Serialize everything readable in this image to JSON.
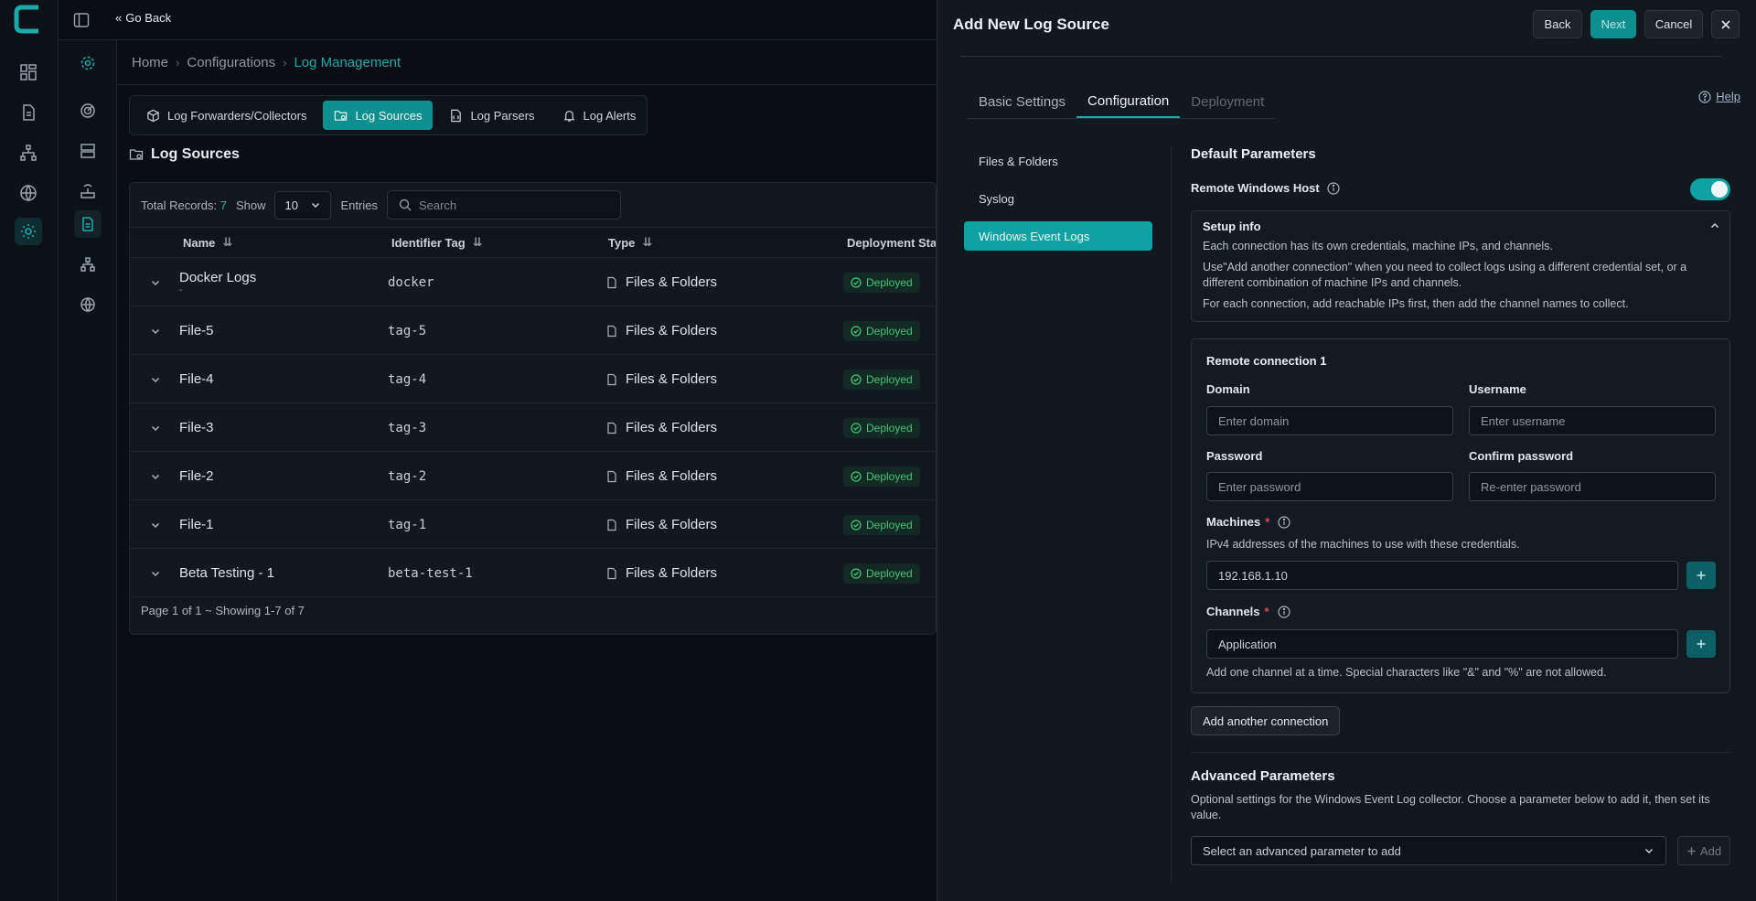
{
  "topbar": {
    "go_back": "Go Back"
  },
  "breadcrumb": {
    "home": "Home",
    "configurations": "Configurations",
    "current": "Log Management"
  },
  "tabs": {
    "forwarders": "Log Forwarders/Collectors",
    "sources": "Log Sources",
    "parsers": "Log Parsers",
    "alerts": "Log Alerts"
  },
  "section_title": "Log Sources",
  "table": {
    "total_label": "Total Records:",
    "total_count": "7",
    "show_label": "Show",
    "show_value": "10",
    "entries_label": "Entries",
    "search_placeholder": "Search",
    "columns": {
      "name": "Name",
      "tag": "Identifier Tag",
      "type": "Type",
      "status": "Deployment Status"
    },
    "rows": [
      {
        "name": "Docker Logs",
        "sub": "-",
        "tag": "docker",
        "type": "Files & Folders",
        "status": "Deployed"
      },
      {
        "name": "File-5",
        "tag": "tag-5",
        "type": "Files & Folders",
        "status": "Deployed"
      },
      {
        "name": "File-4",
        "tag": "tag-4",
        "type": "Files & Folders",
        "status": "Deployed"
      },
      {
        "name": "File-3",
        "tag": "tag-3",
        "type": "Files & Folders",
        "status": "Deployed"
      },
      {
        "name": "File-2",
        "tag": "tag-2",
        "type": "Files & Folders",
        "status": "Deployed"
      },
      {
        "name": "File-1",
        "tag": "tag-1",
        "type": "Files & Folders",
        "status": "Deployed"
      },
      {
        "name": "Beta Testing - 1",
        "tag": "beta-test-1",
        "type": "Files & Folders",
        "status": "Deployed"
      }
    ],
    "footer": "Page 1 of 1 ~ Showing 1-7 of 7"
  },
  "drawer": {
    "title": "Add New Log Source",
    "back": "Back",
    "next": "Next",
    "cancel": "Cancel",
    "tabs": {
      "basic": "Basic Settings",
      "config": "Configuration",
      "deploy": "Deployment"
    },
    "help": "Help",
    "source_types": [
      "Files & Folders",
      "Syslog",
      "Windows Event Logs"
    ],
    "default_params": "Default Parameters",
    "remote_host": "Remote Windows Host",
    "setup": {
      "title": "Setup info",
      "p1": "Each connection has its own credentials, machine IPs, and channels.",
      "p2": "Use\"Add another connection\" when you need to collect logs using a different credential set, or a different combination of machine IPs and channels.",
      "p3": "For each connection, add reachable IPs first, then add the channel names to collect."
    },
    "conn": {
      "title": "Remote connection 1",
      "domain_label": "Domain",
      "domain_ph": "Enter domain",
      "username_label": "Username",
      "username_ph": "Enter username",
      "password_label": "Password",
      "password_ph": "Enter password",
      "confirm_label": "Confirm password",
      "confirm_ph": "Re-enter password",
      "machines_label": "Machines",
      "machines_hint": "IPv4 addresses of the machines to use with these credentials.",
      "machines_value": "192.168.1.10",
      "channels_label": "Channels",
      "channels_value": "Application",
      "channels_hint": "Add one channel at a time. Special characters like \"&\" and \"%\" are not allowed."
    },
    "add_another": "Add another connection",
    "advanced": {
      "title": "Advanced Parameters",
      "desc": "Optional settings for the Windows Event Log collector. Choose a parameter below to add it, then set its value.",
      "select_ph": "Select an advanced parameter to add",
      "add": "Add"
    }
  },
  "colors": {
    "accent": "#0e8f8f",
    "accent_bright": "#19a7a7",
    "success": "#3fc47a",
    "danger": "#e5484d"
  },
  "icons": [
    "logo-icon",
    "dashboard-icon",
    "document-icon",
    "network-icon",
    "globe-icon",
    "settings-icon",
    "sidebar-toggle-icon",
    "chevrons-left-icon",
    "radar-icon",
    "server-icon",
    "router-icon",
    "file-icon",
    "box-icon",
    "folder-icon",
    "bell-icon",
    "search-icon",
    "sort-icon",
    "chevron-down-icon",
    "check-circle-icon",
    "help-circle-icon",
    "close-icon",
    "info-icon",
    "chevron-up-icon",
    "plus-icon"
  ]
}
